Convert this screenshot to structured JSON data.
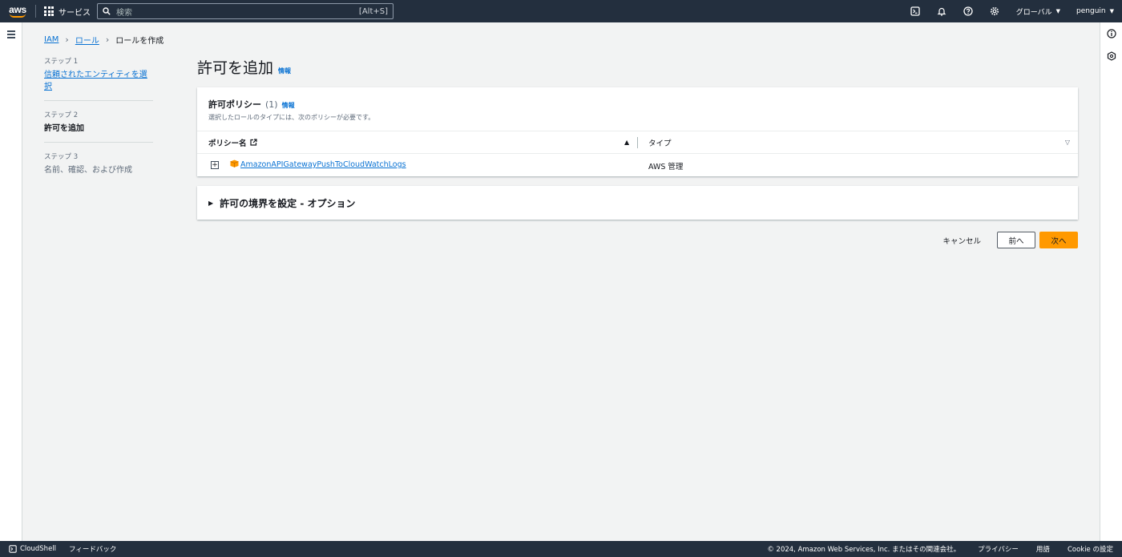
{
  "topnav": {
    "logo_text": "aws",
    "services_label": "サービス",
    "search_placeholder": "検索",
    "search_shortcut": "[Alt+S]",
    "region_label": "グローバル",
    "account_label": "penguin"
  },
  "breadcrumb": {
    "items": [
      "IAM",
      "ロール"
    ],
    "current": "ロールを作成"
  },
  "steps": [
    {
      "label": "ステップ 1",
      "title": "信頼されたエンティティを選択"
    },
    {
      "label": "ステップ 2",
      "title": "許可を追加"
    },
    {
      "label": "ステップ 3",
      "title": "名前、確認、および作成"
    }
  ],
  "page": {
    "title": "許可を追加",
    "info": "情報"
  },
  "policies": {
    "title": "許可ポリシー",
    "count": "(1)",
    "info": "情報",
    "description": "選択したロールのタイプには、次のポリシーが必要です。",
    "columns": {
      "name": "ポリシー名",
      "type": "タイプ"
    },
    "rows": [
      {
        "name": "AmazonAPIGatewayPushToCloudWatchLogs",
        "type": "AWS 管理"
      }
    ]
  },
  "boundary": {
    "title": "許可の境界を設定 - オプション"
  },
  "actions": {
    "cancel": "キャンセル",
    "previous": "前へ",
    "next": "次へ"
  },
  "footer": {
    "cloudshell": "CloudShell",
    "feedback": "フィードバック",
    "copyright": "© 2024, Amazon Web Services, Inc. またはその関連会社。",
    "privacy": "プライバシー",
    "terms": "用語",
    "cookie": "Cookie の設定"
  },
  "colors": {
    "nav_bg": "#232f3e",
    "link": "#0972d3",
    "primary": "#ff9900",
    "page_bg": "#f2f3f3"
  }
}
